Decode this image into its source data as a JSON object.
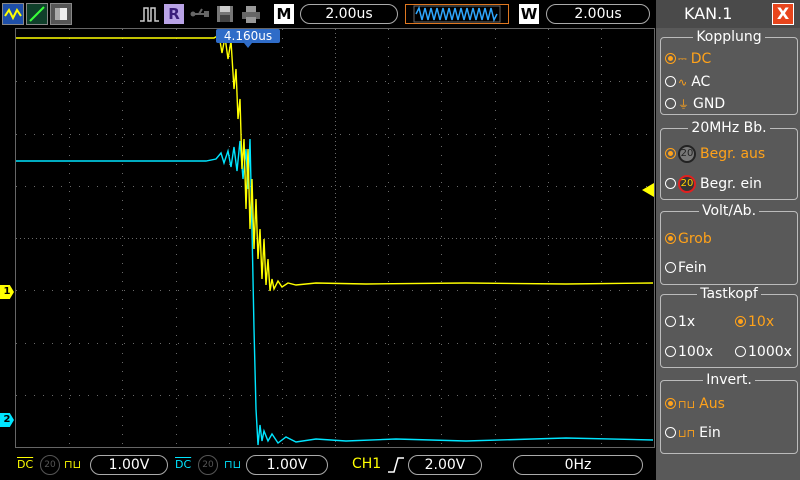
{
  "topbar": {
    "mode_letter_r": "R",
    "mode_letter_m": "M",
    "timebase": "2.00us",
    "mode_letter_w": "W",
    "window_timebase": "2.00us"
  },
  "cursor": {
    "trigger_time_label": "4.160us"
  },
  "channel_markers": {
    "ch1": "1",
    "ch2": "2"
  },
  "panel": {
    "title": "KAN.1",
    "close": "X",
    "coupling": {
      "title": "Kopplung",
      "options": [
        {
          "label": "DC",
          "selected": true
        },
        {
          "label": "AC",
          "selected": false
        },
        {
          "label": "GND",
          "selected": false
        }
      ]
    },
    "bandwidth": {
      "title": "20MHz  Bb.",
      "badge": "20",
      "options": [
        {
          "label": "Begr.  aus",
          "selected": true
        },
        {
          "label": "Begr.  ein",
          "selected": false
        }
      ]
    },
    "volts": {
      "title": "Volt/Ab.",
      "options": [
        {
          "label": "Grob",
          "selected": true
        },
        {
          "label": "Fein",
          "selected": false
        }
      ]
    },
    "probe": {
      "title": "Tastkopf",
      "options": [
        {
          "label": "1x",
          "selected": false
        },
        {
          "label": "10x",
          "selected": true
        },
        {
          "label": "100x",
          "selected": false
        },
        {
          "label": "1000x",
          "selected": false
        }
      ]
    },
    "invert": {
      "title": "Invert.",
      "options": [
        {
          "label": "Aus",
          "selected": true
        },
        {
          "label": "Ein",
          "selected": false
        }
      ]
    }
  },
  "bottombar": {
    "ch1_coupling": "DC",
    "ch1_bw": "20",
    "ch1_scale": "1.00V",
    "ch2_coupling": "DC",
    "ch2_bw": "20",
    "ch2_scale": "1.00V",
    "trigger_source": "CH1",
    "trigger_level": "2.00V",
    "frequency": "0Hz"
  },
  "colors": {
    "ch1": "#ffff00",
    "ch2": "#00e5ff",
    "accent": "#ffa21a",
    "panel_bg": "#595959"
  }
}
